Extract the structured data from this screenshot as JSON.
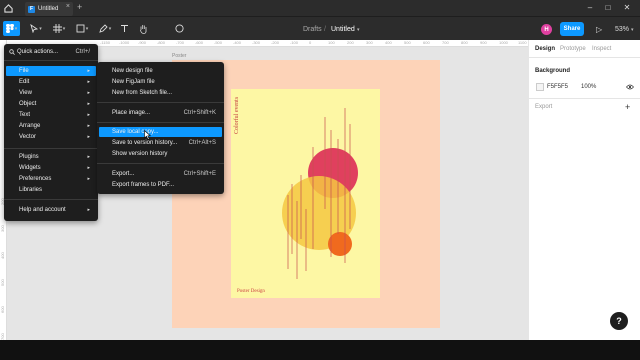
{
  "titlebar": {
    "tab_title": "Untitled",
    "tab_close": "×",
    "add_tab": "+",
    "minimize": "–",
    "maximize": "□",
    "close": "✕"
  },
  "toolbar": {
    "breadcrumb_project": "Drafts",
    "breadcrumb_sep": "/",
    "file_name": "Untitled",
    "avatar_initial": "H",
    "share_label": "Share",
    "play_icon": "▷",
    "zoom": "53%"
  },
  "canvas": {
    "frame_label": "Poster",
    "ruler_top": [
      "-1150",
      "-1000",
      "-900",
      "-800",
      "-700",
      "-600",
      "-500",
      "-400",
      "-300",
      "-200",
      "-100",
      "0",
      "100",
      "200",
      "300",
      "400",
      "500",
      "600",
      "700",
      "800",
      "900",
      "1000",
      "1100",
      "1200",
      "1300",
      "1400",
      "1500"
    ],
    "ruler_left": [
      "200",
      "300",
      "400",
      "500",
      "600",
      "700",
      "800"
    ],
    "poster_title": "Colorful events",
    "poster_footer": "Poster Design",
    "colors": {
      "frame": "#fdd3b8",
      "poster": "#fdf7a4",
      "circle_red": "#e0405e",
      "circle_yellow": "#f5c842",
      "circle_orange": "#f06a1e",
      "lines": "#c65050"
    }
  },
  "main_menu": {
    "items": [
      {
        "label": "Quick actions...",
        "shortcut": "Ctrl+/"
      },
      {
        "label": "File",
        "arrow": "▸"
      },
      {
        "label": "Edit",
        "arrow": "▸"
      },
      {
        "label": "View",
        "arrow": "▸"
      },
      {
        "label": "Object",
        "arrow": "▸"
      },
      {
        "label": "Text",
        "arrow": "▸"
      },
      {
        "label": "Arrange",
        "arrow": "▸"
      },
      {
        "label": "Vector",
        "arrow": "▸"
      },
      {
        "label": "Plugins",
        "arrow": "▸"
      },
      {
        "label": "Widgets",
        "arrow": "▸"
      },
      {
        "label": "Preferences",
        "arrow": "▸"
      },
      {
        "label": "Libraries"
      },
      {
        "label": "Help and account",
        "arrow": "▸"
      }
    ]
  },
  "file_menu": {
    "items": [
      {
        "label": "New design file"
      },
      {
        "label": "New FigJam file"
      },
      {
        "label": "New from Sketch file..."
      },
      {
        "label": "Place image...",
        "shortcut": "Ctrl+Shift+K"
      },
      {
        "label": "Save local copy..."
      },
      {
        "label": "Save to version history...",
        "shortcut": "Ctrl+Alt+S"
      },
      {
        "label": "Show version history"
      },
      {
        "label": "Export...",
        "shortcut": "Ctrl+Shift+E"
      },
      {
        "label": "Export frames to PDF..."
      }
    ]
  },
  "panel": {
    "tabs": [
      "Design",
      "Prototype",
      "Inspect"
    ],
    "background_title": "Background",
    "background_hex": "F5F5F5",
    "background_opacity": "100%",
    "export_title": "Export",
    "add_icon": "+"
  },
  "help_label": "?"
}
